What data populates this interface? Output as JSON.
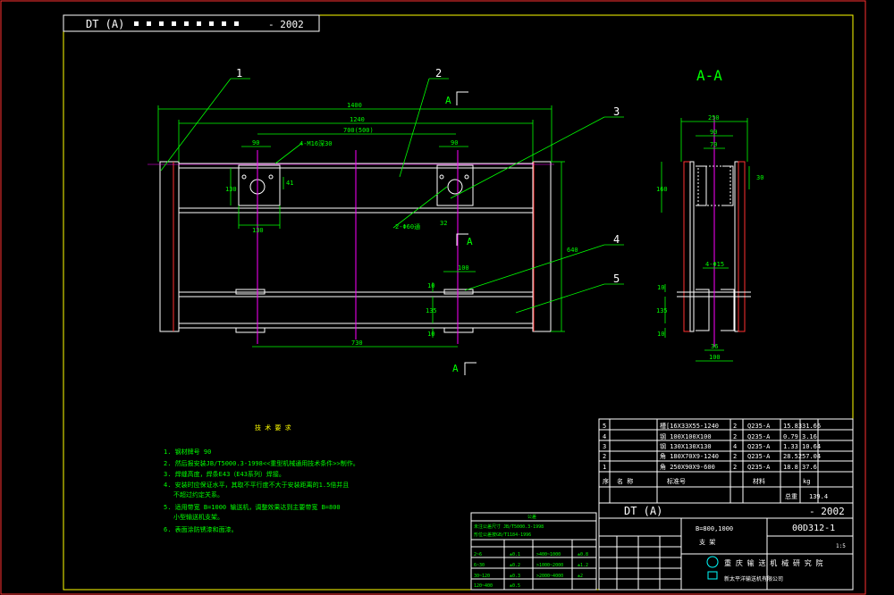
{
  "title_block_top": {
    "code": "DT (A)",
    "suffix": "- 2002"
  },
  "balloons": [
    "1",
    "2",
    "3",
    "4",
    "5"
  ],
  "section": {
    "main": "A-A",
    "mark": "A"
  },
  "dims": {
    "d1400": "1400",
    "d1240": "1240",
    "d700": "700(500)",
    "d90a": "90",
    "d90b": "90",
    "d130v": "130",
    "d41": "41",
    "d130h": "130",
    "d100": "100",
    "d10a": "10",
    "d10b": "10",
    "d135": "135",
    "d730": "730",
    "d640": "640",
    "hole_callout": "4-M16深30",
    "slot_callout": "2-Φ60通",
    "d32": "32",
    "d70": "70",
    "s250": "250",
    "s90": "90",
    "s70": "70",
    "s160": "160",
    "s30": "30",
    "s10": "10",
    "s135": "135",
    "s10b": "10",
    "s36": "36",
    "s100": "100",
    "s4": "4-Φ15"
  },
  "notes": {
    "heading": "技 术 要 求",
    "n1": "1. 钢材牌号     90",
    "n2": "2. 然后报安装JB/T5000.3-1998<<重型机械通用技术条件>>制作。",
    "n3": "3. 焊缝高度，焊条E43（E43系列）焊接。",
    "n4": "4. 安装时应保证水平，其取不平行度不大于安装距离的1.5倍并且",
    "n4b": "不超过约定关系。",
    "n5": "5. 适用带宽 B=1000  输送机，调整效果达到主要带宽 B=800",
    "n5b": "小型输送机支架。",
    "n6": "6. 表面涂防锈漆和面漆。"
  },
  "bom": [
    {
      "no": "5",
      "name": "槽[16X33X55-1240",
      "qty": "2",
      "mat": "Q235-A",
      "unit": "15.83",
      "total": "31.66"
    },
    {
      "no": "4",
      "name": "钢 100X100X100",
      "qty": "2",
      "mat": "Q235-A",
      "unit": "0.79",
      "total": "3.16"
    },
    {
      "no": "3",
      "name": "钢 130X130X130",
      "qty": "4",
      "mat": "Q235-A",
      "unit": "1.33",
      "total": "10.64"
    },
    {
      "no": "2",
      "name": "角 180X70X9-1240",
      "qty": "2",
      "mat": "Q235-A",
      "unit": "28.52",
      "total": "57.04"
    },
    {
      "no": "1",
      "name": "角 250X90X9-600",
      "qty": "2",
      "mat": "Q235-A",
      "unit": "18.8",
      "total": "37.6"
    }
  ],
  "bom_header": {
    "no": "序",
    "name": "名 称",
    "std": "标准号",
    "mat": "材料",
    "kg": "kg",
    "total_label": "总重",
    "total": "139.4"
  },
  "title": {
    "code": "DT (A)",
    "series": "- 2002",
    "belt": "B=800,1000",
    "part_name": "支 架",
    "drawing_no": "00D312-1",
    "institute": "重 庆 输 送 机 械 研 究 院",
    "company": "新太平洋输送机有限公司",
    "scale": "1:5"
  },
  "tol": {
    "head": "公差",
    "l1": "未注公差尺寸 JB/T5000.3-1998",
    "l2": "形位公差按GB/T1184-1996",
    "rows": [
      [
        "2~6",
        "±0.1",
        ">400~1000",
        "±0.8"
      ],
      [
        "6~30",
        "±0.2",
        ">1000~2000",
        "±1.2"
      ],
      [
        "30~120",
        "±0.3",
        ">2000~4000",
        "±2"
      ],
      [
        "120~400",
        "±0.5",
        "",
        ""
      ]
    ]
  }
}
